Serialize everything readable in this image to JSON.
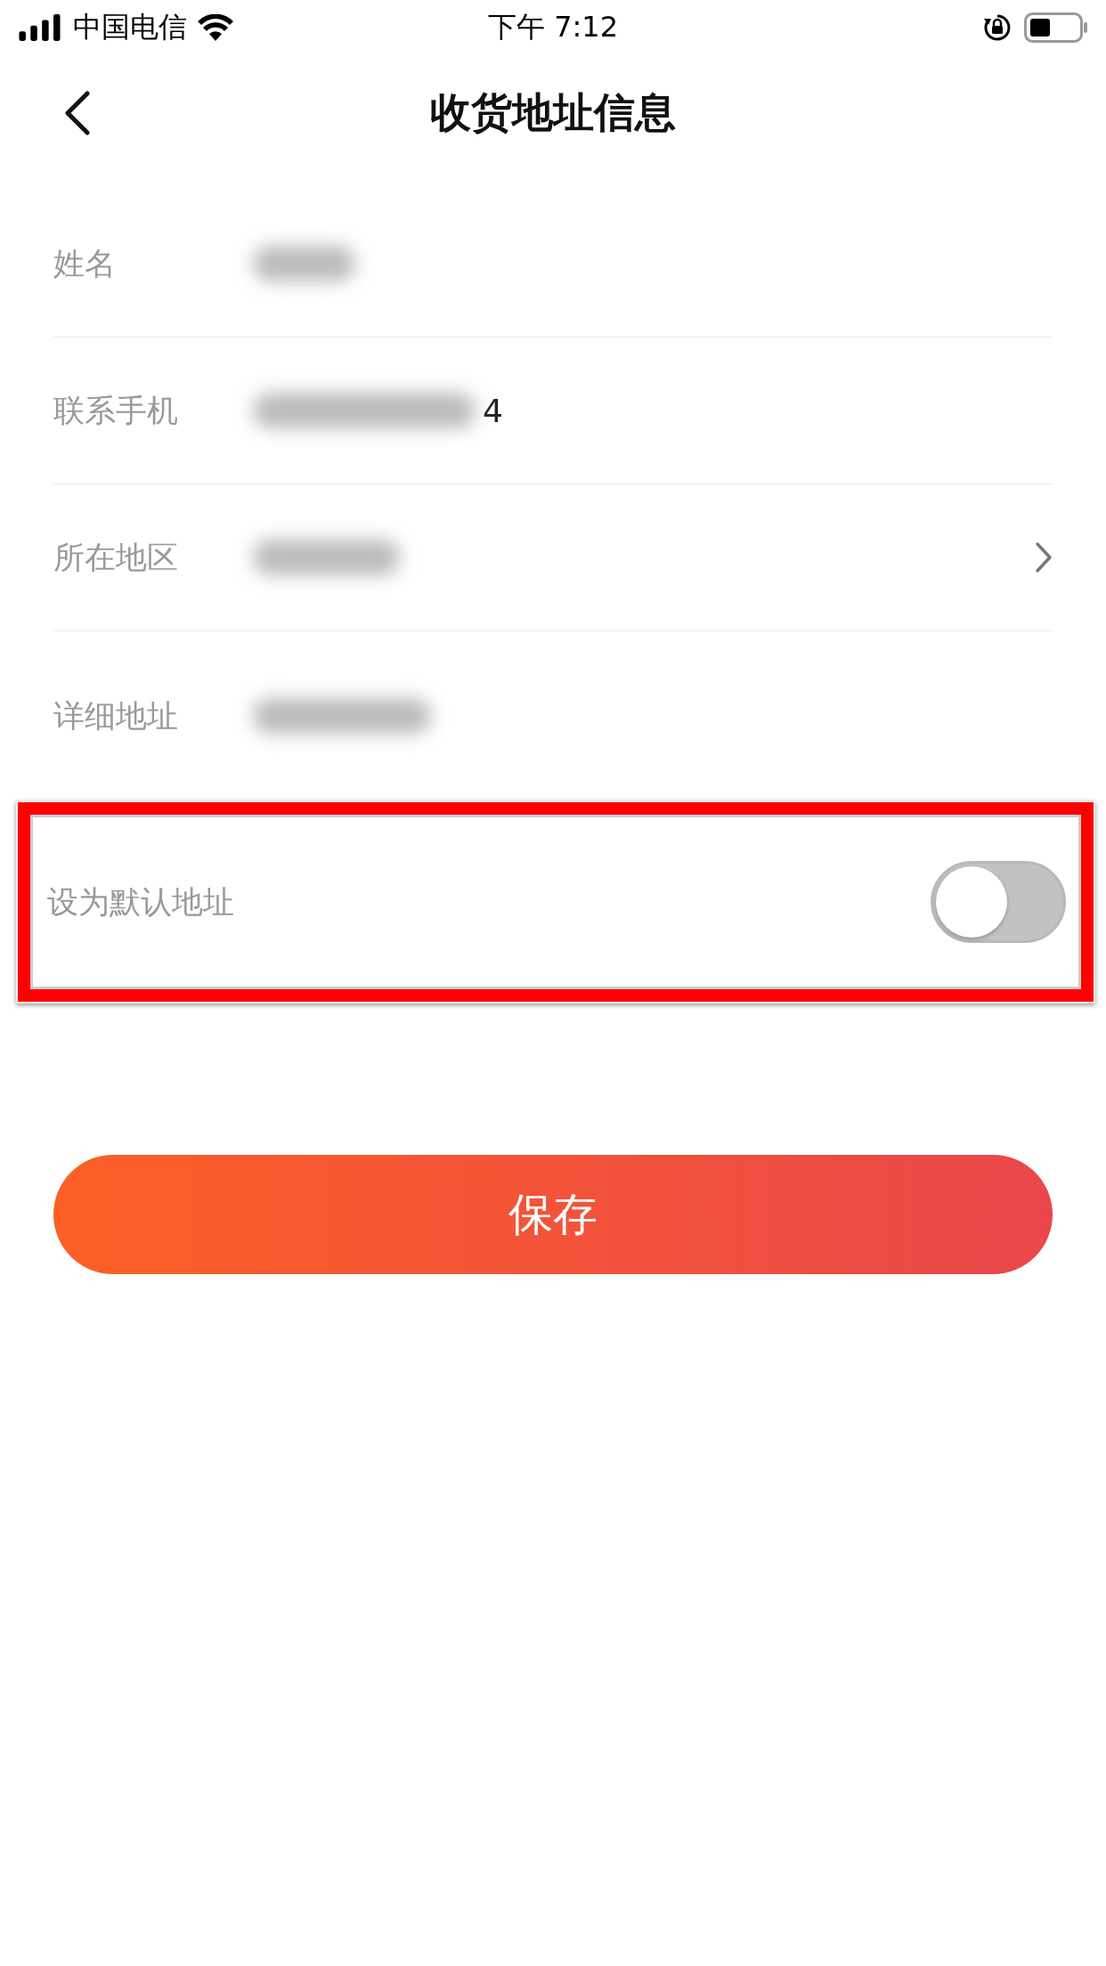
{
  "status_bar": {
    "carrier": "中国电信",
    "time": "下午 7:12"
  },
  "nav": {
    "title": "收货地址信息"
  },
  "fields": [
    {
      "label": "姓名",
      "arrow": false
    },
    {
      "label": "联系手机",
      "suffix": "4",
      "arrow": false
    },
    {
      "label": "所在地区",
      "arrow": true
    },
    {
      "label": "详细地址",
      "arrow": false
    }
  ],
  "default": {
    "label": "设为默认地址",
    "on": false,
    "highlighted": true
  },
  "save_button": "保存"
}
